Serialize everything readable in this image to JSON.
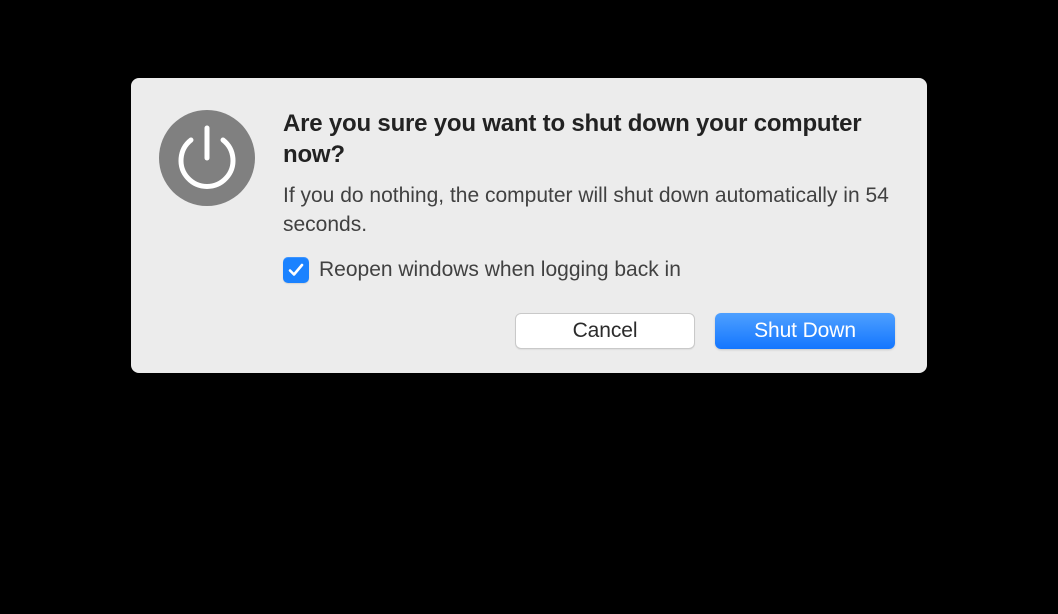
{
  "dialog": {
    "heading": "Are you sure you want to shut down your computer now?",
    "message": "If you do nothing, the computer will shut down automatically in 54 seconds.",
    "checkbox_label": "Reopen windows when logging back in",
    "checkbox_checked": true,
    "cancel_label": "Cancel",
    "confirm_label": "Shut Down"
  }
}
